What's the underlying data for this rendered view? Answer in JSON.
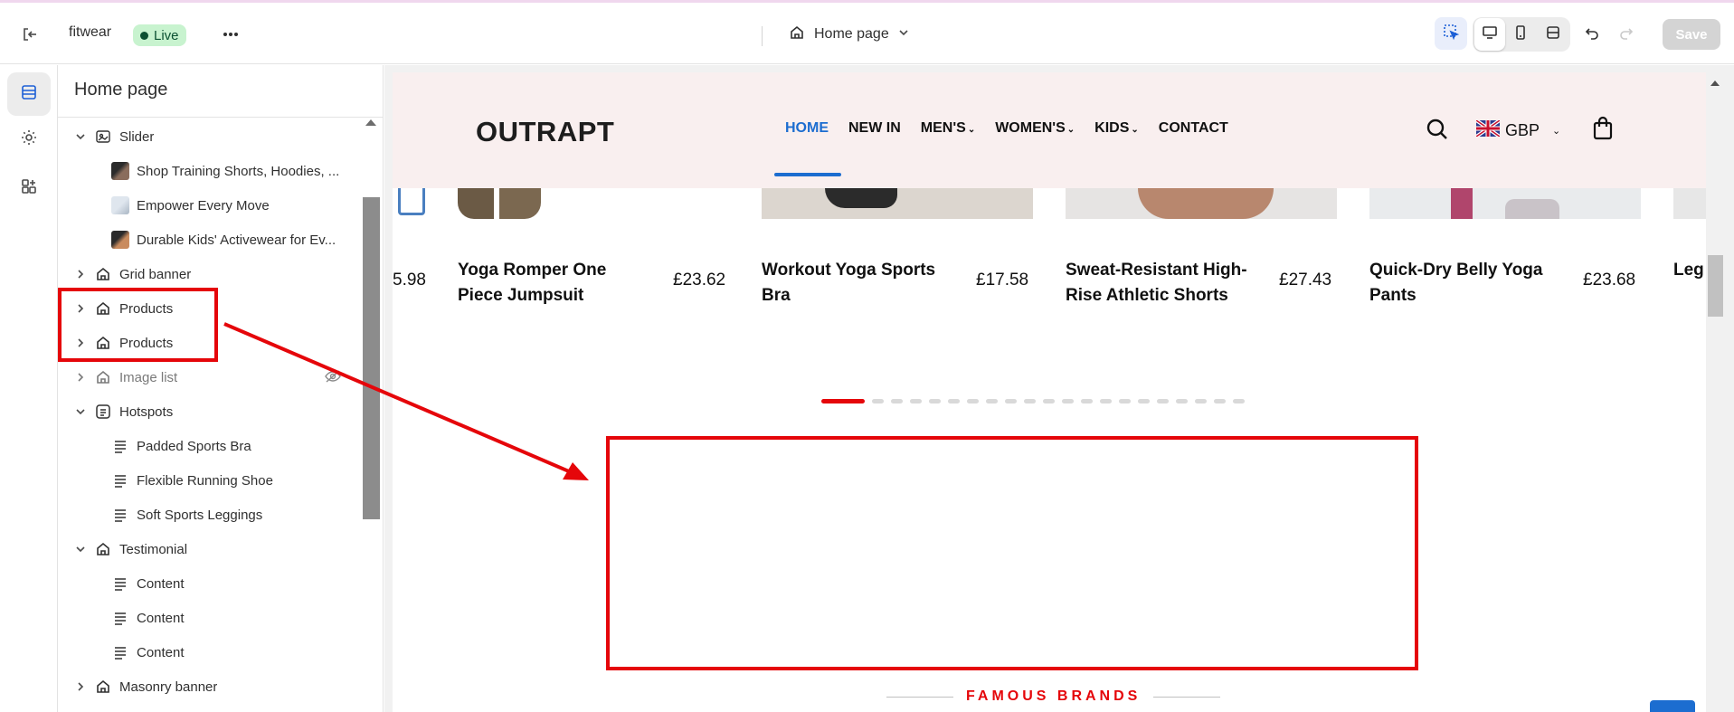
{
  "topbar": {
    "store_name": "fitwear",
    "status_badge": "Live",
    "page_selector": "Home page",
    "save_label": "Save"
  },
  "panel": {
    "title": "Home page",
    "tree": [
      {
        "label": "Slider",
        "level": 0,
        "expanded": true,
        "icon": "slider-icon"
      },
      {
        "label": "Shop Training Shorts, Hoodies, ...",
        "level": 1,
        "icon": "image-thumb"
      },
      {
        "label": "Empower Every Move",
        "level": 1,
        "icon": "image-thumb"
      },
      {
        "label": "Durable Kids' Activewear for Ev...",
        "level": 1,
        "icon": "image-thumb"
      },
      {
        "label": "Grid banner",
        "level": 0,
        "icon": "section-icon"
      },
      {
        "label": "Products",
        "level": 0,
        "icon": "section-icon"
      },
      {
        "label": "Products",
        "level": 0,
        "icon": "section-icon"
      },
      {
        "label": "Image list",
        "level": 0,
        "icon": "section-icon",
        "hidden": true
      },
      {
        "label": "Hotspots",
        "level": 0,
        "expanded": true,
        "icon": "hotspots-icon"
      },
      {
        "label": "Padded Sports Bra",
        "level": 1,
        "icon": "text-block-icon"
      },
      {
        "label": "Flexible Running Shoe",
        "level": 1,
        "icon": "text-block-icon"
      },
      {
        "label": "Soft Sports Leggings",
        "level": 1,
        "icon": "text-block-icon"
      },
      {
        "label": "Testimonial",
        "level": 0,
        "expanded": true,
        "icon": "section-icon"
      },
      {
        "label": "Content",
        "level": 1,
        "icon": "text-block-icon"
      },
      {
        "label": "Content",
        "level": 1,
        "icon": "text-block-icon"
      },
      {
        "label": "Content",
        "level": 1,
        "icon": "text-block-icon"
      },
      {
        "label": "Masonry banner",
        "level": 0,
        "icon": "section-icon"
      }
    ]
  },
  "preview": {
    "logo": "OUTRAPT",
    "nav": [
      {
        "label": "HOME",
        "active": true,
        "dropdown": false
      },
      {
        "label": "NEW IN",
        "active": false,
        "dropdown": false
      },
      {
        "label": "MEN'S",
        "active": false,
        "dropdown": true
      },
      {
        "label": "WOMEN'S",
        "active": false,
        "dropdown": true
      },
      {
        "label": "KIDS",
        "active": false,
        "dropdown": true
      },
      {
        "label": "CONTACT",
        "active": false,
        "dropdown": false
      }
    ],
    "currency": "GBP",
    "products": [
      {
        "name": "",
        "price": "5.98"
      },
      {
        "name": "Yoga Romper One Piece Jumpsuit",
        "price": "£23.62"
      },
      {
        "name": "Workout Yoga Sports Bra",
        "price": "£17.58"
      },
      {
        "name": "Sweat-Resistant High-Rise Athletic Shorts",
        "price": "£27.43"
      },
      {
        "name": "Quick-Dry Belly Yoga Pants",
        "price": "£23.68"
      },
      {
        "name": "Leg",
        "price": ""
      }
    ],
    "slider_dots": 21,
    "slider_active_index": 0,
    "famous_brands": "FAMOUS BRANDS"
  },
  "colors": {
    "accent": "#1c6dd0",
    "annotation_red": "#e5060a",
    "header_bg": "#f9efef",
    "live_badge_bg": "#c8f3cf"
  }
}
